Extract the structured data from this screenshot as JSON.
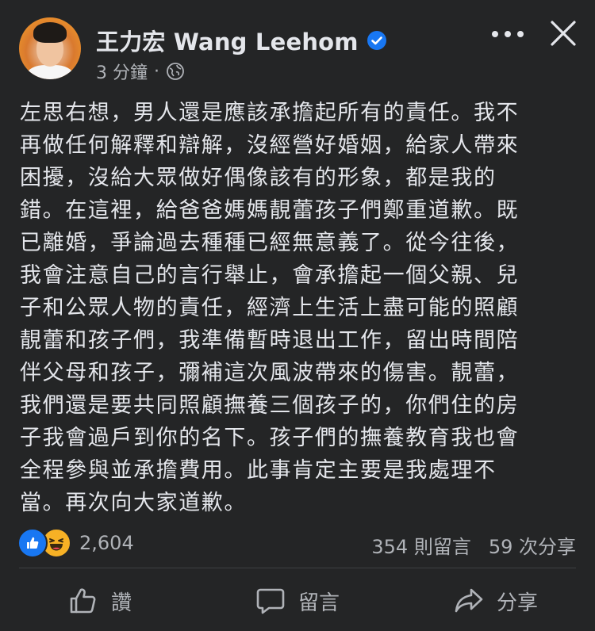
{
  "post": {
    "author": "王力宏 Wang Leehom",
    "timestamp": "3 分鐘",
    "separator": "·",
    "visibility_icon": "globe-icon",
    "text": "左思右想，男人還是應該承擔起所有的責任。我不\n再做任何解釋和辯解，沒經營好婚姻，給家人帶來\n困擾，沒給大眾做好偶像該有的形象，都是我的\n錯。在這裡，給爸爸媽媽靚蕾孩子們鄭重道歉。既\n已離婚，爭論過去種種已經無意義了。從今往後，\n我會注意自己的言行舉止，會承擔起一個父親、兒\n子和公眾人物的責任，經濟上生活上盡可能的照顧\n靚蕾和孩子們，我準備暫時退出工作，留出時間陪\n伴父母和孩子，彌補這次風波帶來的傷害。靚蕾，\n我們還是要共同照顧撫養三個孩子的，你們住的房\n子我會過戶到你的名下。孩子們的撫養教育我也會\n全程參與並承擔費用。此事肯定主要是我處理不\n當。再次向大家道歉。"
  },
  "stats": {
    "reaction_count": "2,604",
    "comments": "354 則留言",
    "shares": "59 次分享"
  },
  "actions": {
    "like": "讚",
    "comment": "留言",
    "share": "分享"
  },
  "colors": {
    "background": "#242526",
    "text_primary": "#e4e6eb",
    "text_secondary": "#b0b3b8",
    "verified_blue": "#1877f2",
    "like_blue": "#1877f2",
    "haha_yellow": "#f7b125"
  }
}
